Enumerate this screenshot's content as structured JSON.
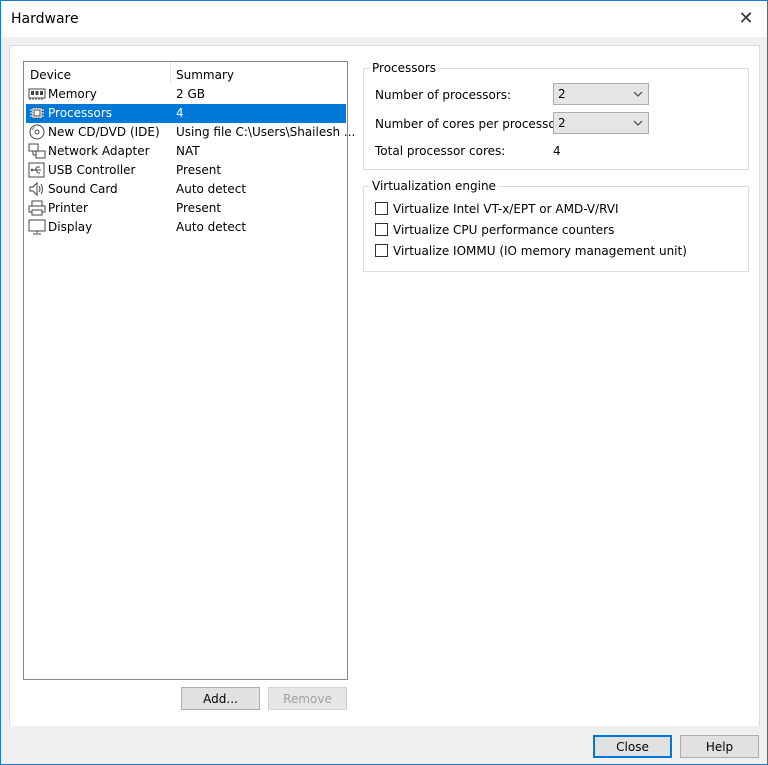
{
  "window": {
    "title": "Hardware",
    "close_glyph": "✕"
  },
  "device_list": {
    "columns": {
      "device": "Device",
      "summary": "Summary"
    },
    "rows": [
      {
        "device": "Memory",
        "summary": "2 GB",
        "icon": "memory-icon"
      },
      {
        "device": "Processors",
        "summary": "4",
        "icon": "processor-icon",
        "selected": true
      },
      {
        "device": "New CD/DVD (IDE)",
        "summary": "Using file C:\\Users\\Shailesh ...",
        "icon": "cd-dvd-icon"
      },
      {
        "device": "Network Adapter",
        "summary": "NAT",
        "icon": "network-adapter-icon"
      },
      {
        "device": "USB Controller",
        "summary": "Present",
        "icon": "usb-icon"
      },
      {
        "device": "Sound Card",
        "summary": "Auto detect",
        "icon": "speaker-icon"
      },
      {
        "device": "Printer",
        "summary": "Present",
        "icon": "printer-icon"
      },
      {
        "device": "Display",
        "summary": "Auto detect",
        "icon": "monitor-icon"
      }
    ]
  },
  "list_buttons": {
    "add": "Add...",
    "remove": "Remove"
  },
  "processors": {
    "group_title": "Processors",
    "num_processors_label": "Number of processors:",
    "num_processors_value": "2",
    "cores_label": "Number of cores per processor:",
    "cores_value": "2",
    "total_label": "Total processor cores:",
    "total_value": "4"
  },
  "virtualization": {
    "group_title": "Virtualization engine",
    "options": [
      {
        "label": "Virtualize Intel VT-x/EPT or AMD-V/RVI",
        "checked": false
      },
      {
        "label": "Virtualize CPU performance counters",
        "checked": false
      },
      {
        "label": "Virtualize IOMMU (IO memory management unit)",
        "checked": false
      }
    ]
  },
  "footer": {
    "close": "Close",
    "help": "Help"
  },
  "colors": {
    "selection": "#0078d7",
    "window_border": "#1979ca"
  }
}
